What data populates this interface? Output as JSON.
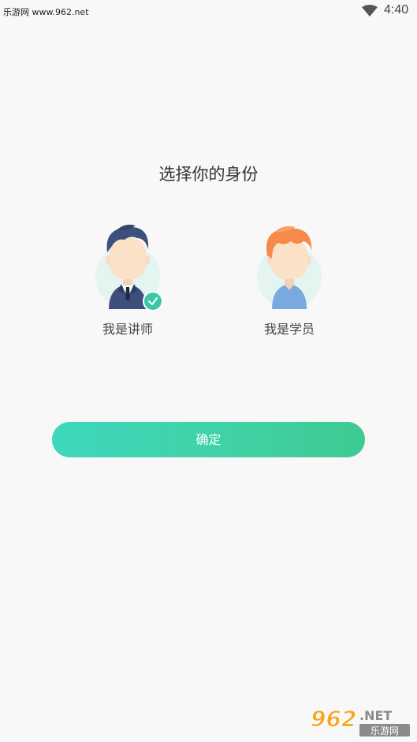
{
  "status_bar": {
    "watermark": "乐游网 www.962.net",
    "time": "4:40"
  },
  "page": {
    "title": "选择你的身份"
  },
  "roles": [
    {
      "label": "我是讲师",
      "selected": true,
      "icon": "teacher-avatar-icon"
    },
    {
      "label": "我是学员",
      "selected": false,
      "icon": "student-avatar-icon"
    }
  ],
  "confirm": {
    "label": "确定"
  },
  "brand_watermark": {
    "number": "962",
    "suffix": ".NET",
    "name": "乐游网"
  },
  "colors": {
    "accent": "#3ac9a4",
    "button_gradient_start": "#3ed7bc",
    "button_gradient_end": "#3fca92",
    "background": "#f8f8f8"
  }
}
